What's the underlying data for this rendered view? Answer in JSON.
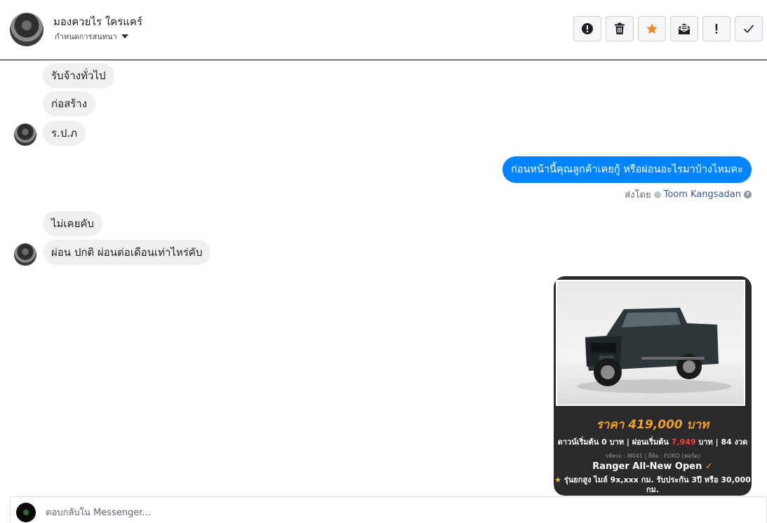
{
  "header": {
    "name": "มองควยไร ใครแคร์",
    "subtitle": "กำหนดการสนทนา",
    "toolbar": [
      {
        "icon": "alert-circle-icon"
      },
      {
        "icon": "trash-icon"
      },
      {
        "icon": "star-icon",
        "color": "#f0892c"
      },
      {
        "icon": "mark-unread-icon"
      },
      {
        "icon": "exclamation-icon"
      },
      {
        "icon": "checkmark-icon"
      }
    ]
  },
  "messages": {
    "incoming_1": "รับจ้างทั่วไป",
    "incoming_2": "ก่อสร้าง",
    "incoming_3": "ร.ป.ภ",
    "outgoing_1": "ก่อนหน้านี้คุณลูกค้าเคยกู้ หรือผ่อนอะไรมาบ้างไหมคะ",
    "sent_by_label": "ส่งโดย",
    "sent_by_name": "Toom Kangsadan",
    "incoming_4": "ไม่เคยคับ",
    "incoming_5": "ผ่อน ปกติ ผ่อนต่อเดือนเท่าไหร่คับ"
  },
  "car_card": {
    "price": "ราคา 419,000 บาท",
    "down": "ดาวน์เริ่มต้น 0 บาท | ผ่อนเริ่มต้น",
    "installment": "7,949",
    "terms": "บาท | 84 งวด",
    "meta": "รหัสรถ : M041 | ยี่ห้อ : FORD (ฟอร์ด)",
    "model": "Ranger All-New Open",
    "details": "รุ่นยกสูง ไมล์ 9x,xxx กม. รับประกัน 3ปี หรือ 30,000 กม.",
    "accent_color": "#f0a030"
  },
  "reply": {
    "placeholder": "ตอบกลับใน Messenger..."
  }
}
